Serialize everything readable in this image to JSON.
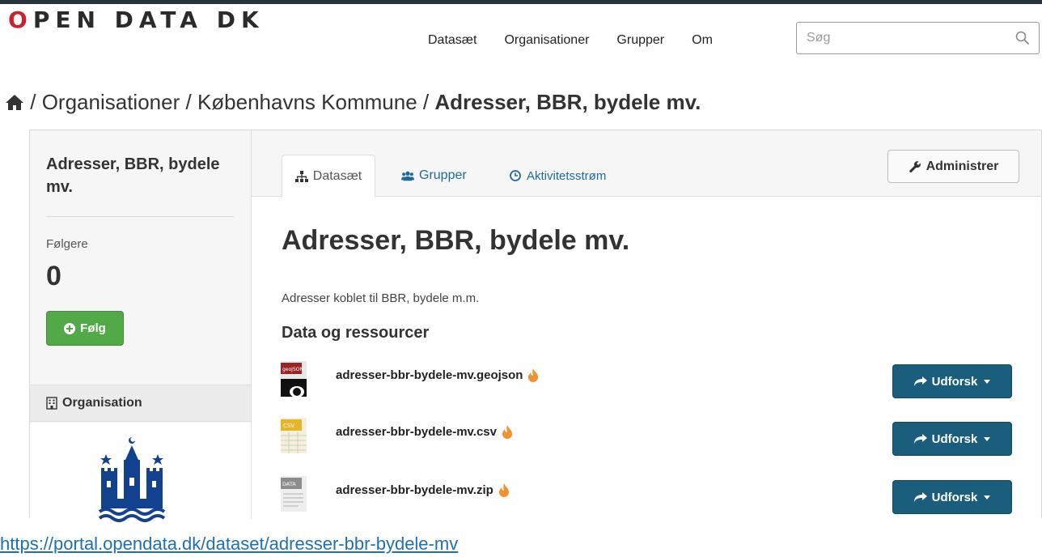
{
  "logo": {
    "first_letter": "O",
    "rest": "PEN DATA DK"
  },
  "nav": {
    "items": [
      "Datasæt",
      "Organisationer",
      "Grupper",
      "Om"
    ]
  },
  "search": {
    "placeholder": "Søg",
    "icon": "search-icon"
  },
  "breadcrumb": {
    "home_icon": "home-icon",
    "sep": "/",
    "items": [
      "Organisationer",
      "Københavns Kommune"
    ],
    "active": "Adresser, BBR, bydele mv."
  },
  "sidebar": {
    "title": "Adresser, BBR, bydele mv.",
    "followers_label": "Følgere",
    "followers_count": "0",
    "follow_button": "Følg",
    "org_header": "Organisation"
  },
  "tabs": [
    {
      "label": "Datasæt",
      "icon": "sitemap-icon",
      "active": true
    },
    {
      "label": "Grupper",
      "icon": "users-icon",
      "active": false
    },
    {
      "label": "Aktivitetsstrøm",
      "icon": "clock-icon",
      "active": false
    }
  ],
  "admin_button": "Administrer",
  "dataset": {
    "title": "Adresser, BBR, bydele mv.",
    "description": "Adresser koblet til BBR, bydele m.m.",
    "resources_heading": "Data og ressourcer",
    "resources": [
      {
        "name": "adresser-bbr-bydele-mv.geojson",
        "format": "geoJSON",
        "explore": "Udforsk"
      },
      {
        "name": "adresser-bbr-bydele-mv.csv",
        "format": "CSV",
        "explore": "Udforsk"
      },
      {
        "name": "adresser-bbr-bydele-mv.zip",
        "format": "DATA",
        "explore": "Udforsk"
      }
    ]
  },
  "url": "https://portal.opendata.dk/dataset/adresser-bbr-bydele-mv",
  "colors": {
    "accent_red": "#c8242f",
    "follow_green": "#52a947",
    "explore_blue": "#1a5d7c",
    "link_blue": "#1f6a99"
  }
}
